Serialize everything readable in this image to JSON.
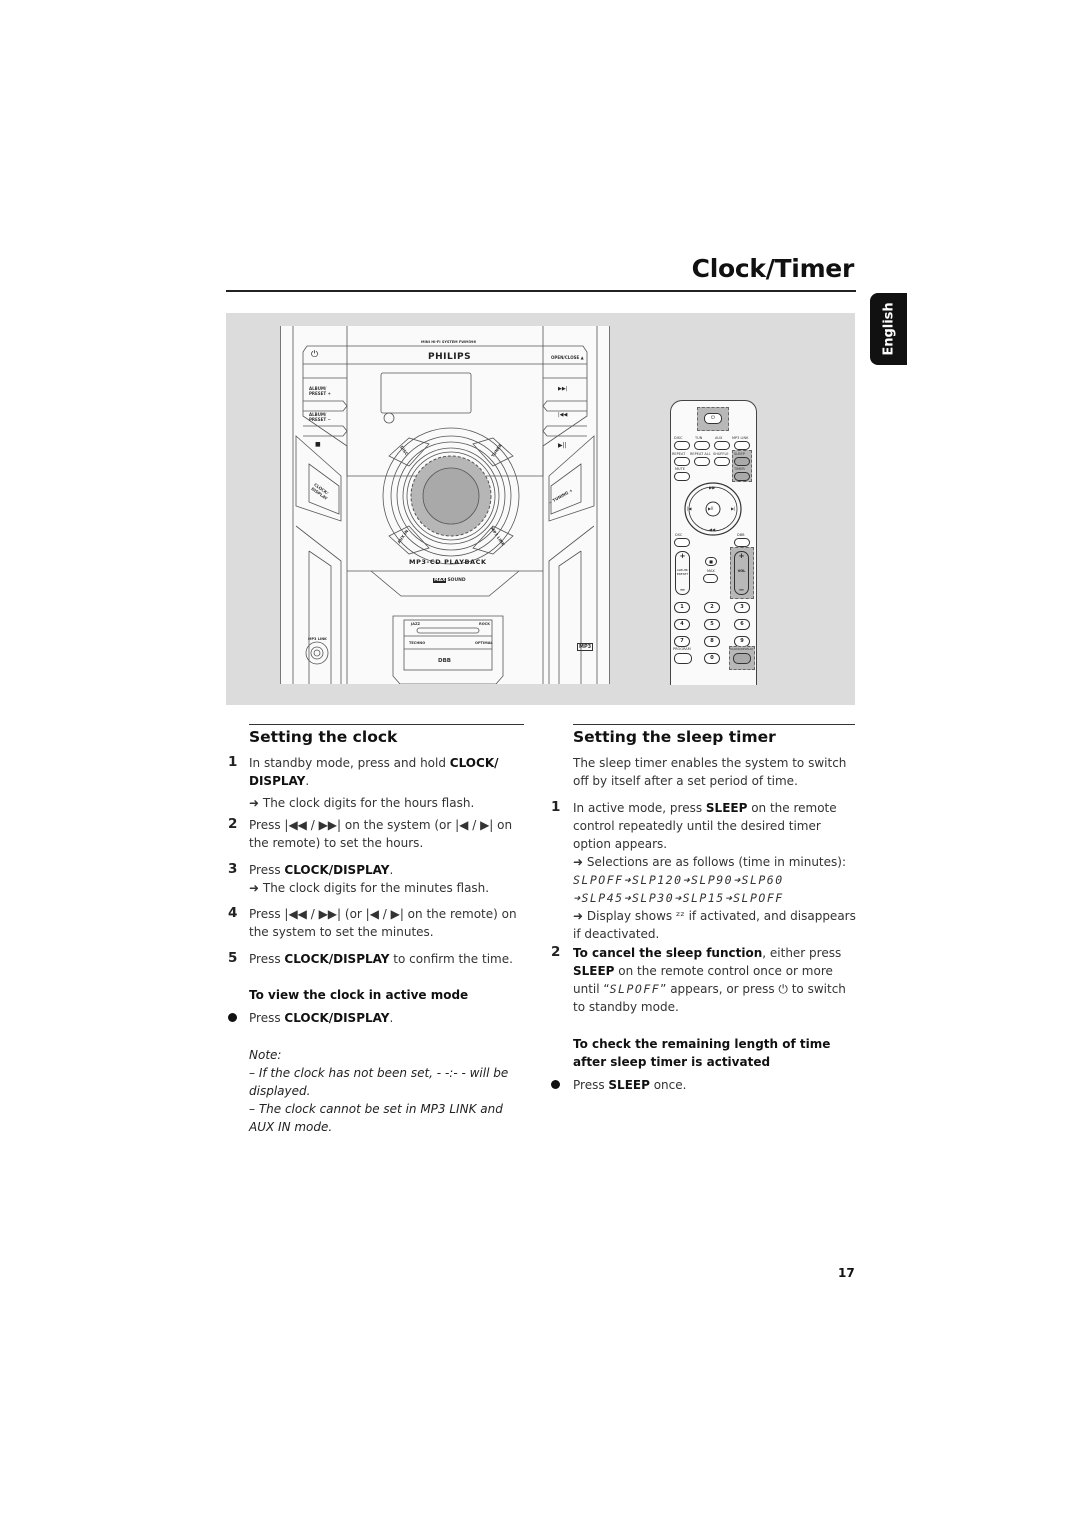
{
  "header": {
    "title": "Clock/Timer",
    "language_tab": "English"
  },
  "figure": {
    "stereo": {
      "model_text": "MINI HI-FI SYSTEM FWM396",
      "brand": "PHILIPS",
      "standby_icon": "power-icon",
      "open_close": "OPEN/CLOSE ▲",
      "album_preset_plus": "ALBUM/ PRESET +",
      "album_preset_minus": "ALBUM/ PRESET −",
      "stop_icon": "■",
      "next_icon": "▶▶|",
      "prev_icon": "|◀◀",
      "play_pause_icon": "▶||",
      "clock_display": "CLOCK/ DISPLAY",
      "tuning": "− TUNING +",
      "disc": "DISC",
      "tuner": "TUNER",
      "aux_in": "AUX IN",
      "mp3_link": "MP3 LINK",
      "mp3cd_playback": "MP3-CD PLAYBACK",
      "maxsound_max": "MAX",
      "maxsound_sound": "SOUND",
      "jazz": "JAZZ",
      "rock": "ROCK",
      "techno": "TECHNO",
      "optimal": "OPTIMAL",
      "dbb": "DBB",
      "mp3_link_jack": "MP3 LINK",
      "mp3_logo": "MP3"
    },
    "remote": {
      "row1": [
        "DISC",
        "TUN",
        "AUX",
        "MP3 LINK"
      ],
      "row2": [
        "REPEAT",
        "REPEAT ALL",
        "SHUFFLE",
        "SLEEP"
      ],
      "row3": [
        "MUTE",
        "TIMER"
      ],
      "nav_up": "▶▶",
      "nav_down": "◀◀",
      "nav_left": "|◀",
      "nav_right": "▶|",
      "nav_center": "▶II",
      "disc_lbl": "DSC",
      "dbb_lbl": "DBB",
      "album_preset": "ALBUM/ PRESET",
      "max": "MAX",
      "vol": "VOL",
      "plus": "+",
      "minus": "−",
      "stop": "■",
      "digits": [
        "1",
        "2",
        "3",
        "4",
        "5",
        "6",
        "7",
        "8",
        "9",
        "0"
      ],
      "program": "PROGRAM",
      "clock_display": "CLOCK/DISPLAY"
    }
  },
  "setting_clock": {
    "heading": "Setting the clock",
    "steps": [
      {
        "num": "1",
        "pre": "In standby mode, press and hold ",
        "bold": "CLOCK/ DISPLAY",
        "post": ".",
        "result": "➜ The clock digits for the hours flash."
      },
      {
        "num": "2",
        "text": "Press |◀◀ / ▶▶| on the system (or |◀ / ▶| on the remote) to set the hours."
      },
      {
        "num": "3",
        "pre": "Press ",
        "bold": "CLOCK/DISPLAY",
        "post": ".",
        "result": "➜ The clock digits for the minutes flash."
      },
      {
        "num": "4",
        "text": "Press |◀◀ / ▶▶| (or |◀ / ▶| on the remote) on the system to set the minutes."
      },
      {
        "num": "5",
        "pre": "Press ",
        "bold": "CLOCK/DISPLAY",
        "post": " to confirm the time."
      }
    ],
    "active_mode_heading": "To view the clock in active mode",
    "active_mode_bullet": {
      "pre": "Press ",
      "bold": "CLOCK/DISPLAY",
      "post": "."
    },
    "note_label": "Note:",
    "notes": [
      "– If the clock has not been set, - -:- - will be displayed.",
      "– The clock cannot be set in MP3 LINK and AUX IN mode."
    ]
  },
  "sleep_timer": {
    "heading": "Setting the sleep timer",
    "intro": "The sleep timer enables the system to switch off by itself after a set period of time.",
    "step1": {
      "num": "1",
      "pre": "In active mode, press ",
      "bold": "SLEEP",
      "post": " on the remote control repeatedly until the desired timer option appears."
    },
    "selections_intro": "➜ Selections are as follows (time in minutes):",
    "selections": [
      "SLPOFF",
      "SLP120",
      "SLP90",
      "SLP60",
      "SLP45",
      "SLP30",
      "SLP15",
      "SLPOFF"
    ],
    "display_note": "➜ Display shows ᶻᶻ if activated, and disappears if deactivated.",
    "step2": {
      "num": "2",
      "bold1": "To cancel the sleep function",
      "mid1": ", either press ",
      "bold2": "SLEEP",
      "mid2": " on the remote control once or more until “",
      "lcd": "SLPOFF",
      "post": "” appears, or press ⏻ to switch to standby mode."
    },
    "remaining_heading": "To check the remaining length of time after sleep timer is activated",
    "remaining_bullet": {
      "pre": "Press ",
      "bold": "SLEEP",
      "post": " once."
    }
  },
  "footer": {
    "page_number": "17"
  }
}
